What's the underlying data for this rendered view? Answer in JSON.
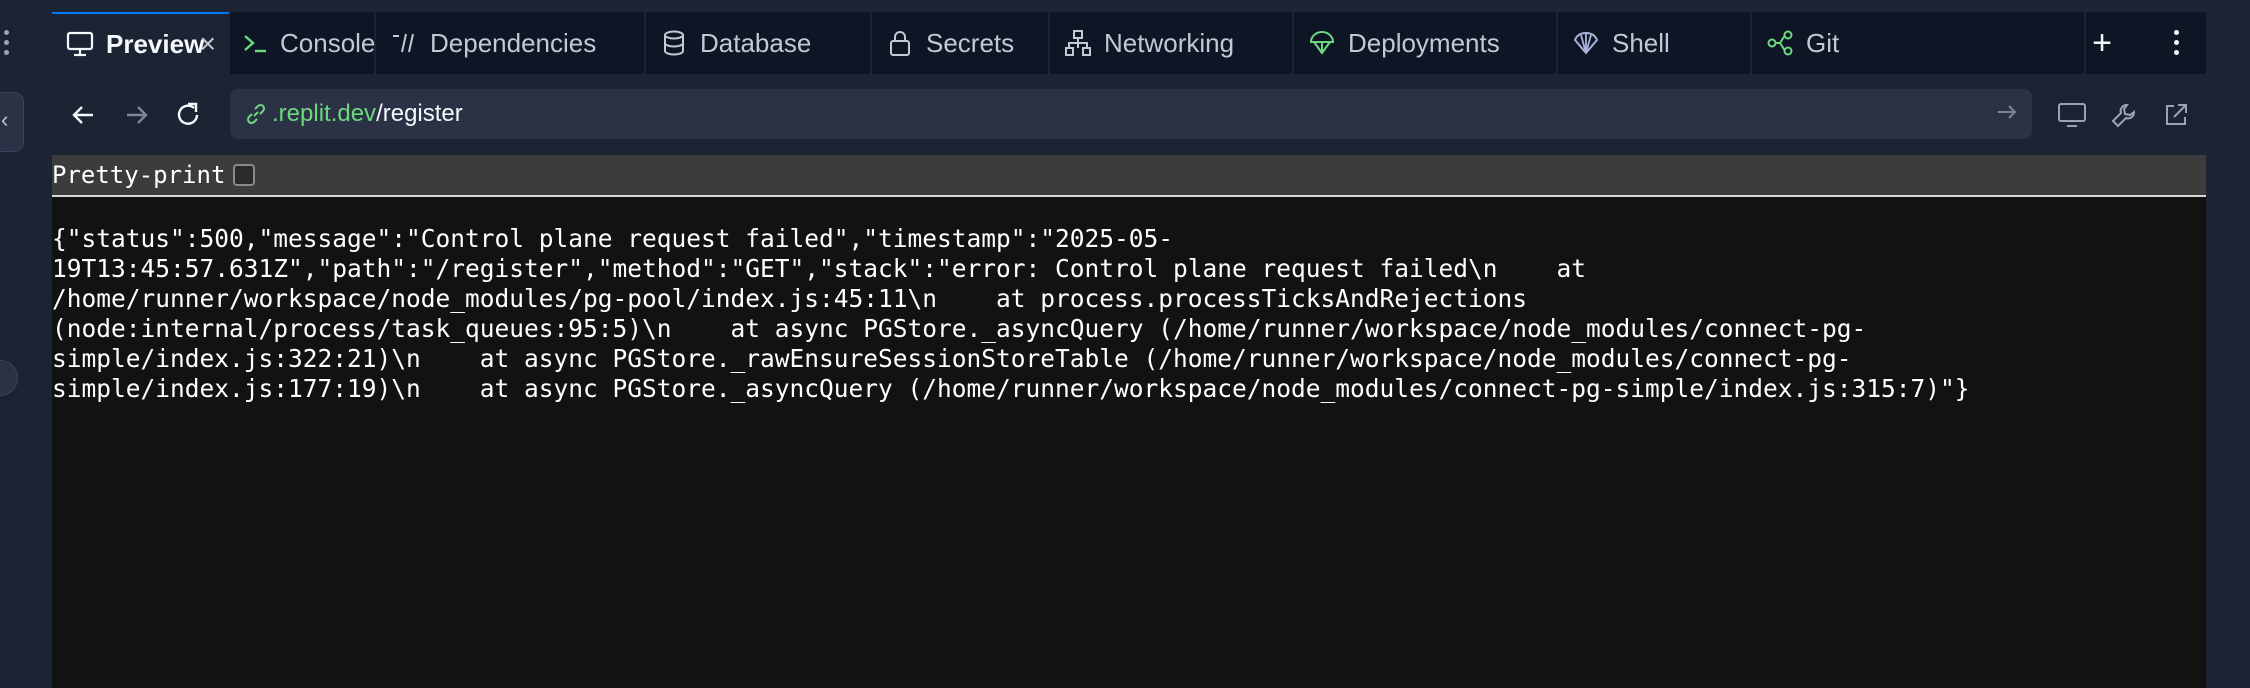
{
  "tabs": [
    {
      "label": "Preview",
      "icon": "monitor-icon",
      "active": true
    },
    {
      "label": "Console",
      "icon": "terminal-prompt-icon"
    },
    {
      "label": "Dependencies",
      "icon": "dependencies-icon"
    },
    {
      "label": "Database",
      "icon": "database-icon"
    },
    {
      "label": "Secrets",
      "icon": "lock-icon"
    },
    {
      "label": "Networking",
      "icon": "network-icon"
    },
    {
      "label": "Deployments",
      "icon": "deployments-icon"
    },
    {
      "label": "Shell",
      "icon": "shell-icon"
    },
    {
      "label": "Git",
      "icon": "git-icon"
    }
  ],
  "tab_close_glyph": "×",
  "tab_add_glyph": "+",
  "url": {
    "host": ".replit.dev",
    "path": "/register"
  },
  "viewer": {
    "pretty_print_label": "Pretty-print",
    "pretty_print_checked": false
  },
  "response_lines": [
    "{\"status\":500,\"message\":\"Control plane request failed\",\"timestamp\":\"2025-05-",
    "19T13:45:57.631Z\",\"path\":\"/register\",\"method\":\"GET\",\"stack\":\"error: Control plane request failed\\n    at",
    "/home/runner/workspace/node_modules/pg-pool/index.js:45:11\\n    at process.processTicksAndRejections",
    "(node:internal/process/task_queues:95:5)\\n    at async PGStore._asyncQuery (/home/runner/workspace/node_modules/connect-pg-",
    "simple/index.js:322:21)\\n    at async PGStore._rawEnsureSessionStoreTable (/home/runner/workspace/node_modules/connect-pg-",
    "simple/index.js:177:19)\\n    at async PGStore._asyncQuery (/home/runner/workspace/node_modules/connect-pg-simple/index.js:315:7)\"}"
  ],
  "colors": {
    "accent": "#0079f2",
    "url_host": "#6cd97e",
    "surface": "#1c2333",
    "content_bg": "#121212"
  }
}
